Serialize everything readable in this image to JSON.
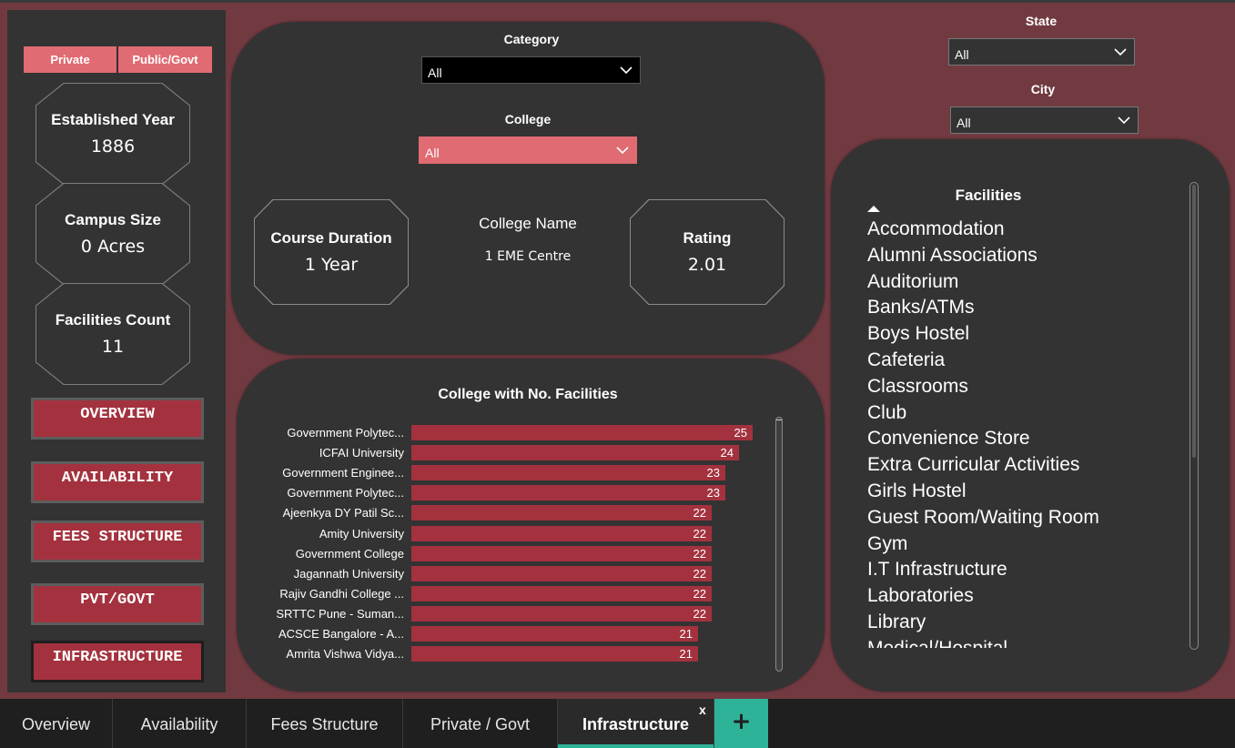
{
  "left": {
    "segments": [
      "Private",
      "Public/Govt"
    ],
    "kpis": [
      {
        "label": "Established Year",
        "value": "1886"
      },
      {
        "label": "Campus Size",
        "value": "0 Acres"
      },
      {
        "label": "Facilities Count",
        "value": "11"
      }
    ],
    "nav": [
      "OVERVIEW",
      "AVAILABILITY",
      "FEES STRUCTURE",
      "PVT/GOVT",
      "INFRASTRUCTURE"
    ]
  },
  "filters": {
    "category": {
      "title": "Category",
      "value": "All"
    },
    "college": {
      "title": "College",
      "value": "All"
    },
    "state": {
      "title": "State",
      "value": "All"
    },
    "city": {
      "title": "City",
      "value": "All"
    }
  },
  "center": {
    "course_duration": {
      "label": "Course Duration",
      "value": "1 Year"
    },
    "college_name": {
      "label": "College Name",
      "value": "1 EME Centre"
    },
    "rating": {
      "label": "Rating",
      "value": "2.01"
    }
  },
  "chart_data": {
    "type": "bar",
    "orientation": "horizontal",
    "title": "College with No. Facilities",
    "categories": [
      "Government Polytec...",
      "ICFAI University",
      "Government Enginee...",
      "Government Polytec...",
      "Ajeenkya DY Patil Sc...",
      "Amity University",
      "Government College",
      "Jagannath University",
      "Rajiv Gandhi College ...",
      "SRTTC Pune - Suman...",
      "ACSCE Bangalore - A...",
      "Amrita Vishwa Vidya..."
    ],
    "values": [
      25,
      24,
      23,
      23,
      22,
      22,
      22,
      22,
      22,
      22,
      21,
      21
    ],
    "color": "#a3323e"
  },
  "facilities": {
    "title": "Facilities",
    "items": [
      "Accommodation",
      "Alumni Associations",
      "Auditorium",
      "Banks/ATMs",
      "Boys Hostel",
      "Cafeteria",
      "Classrooms",
      "Club",
      "Convenience Store",
      "Extra Curricular Activities",
      "Girls Hostel",
      "Guest Room/Waiting Room",
      "Gym",
      "I.T Infrastructure",
      "Laboratories",
      "Library",
      "Medical/Hospital"
    ]
  },
  "tabs": [
    "Overview",
    "Availability",
    "Fees Structure",
    "Private / Govt",
    "Infrastructure"
  ],
  "active_tab": "Infrastructure",
  "tab_close": "x",
  "add_tab": "+",
  "colors": {
    "accent": "#e06b72",
    "bar": "#a3323e",
    "background": "#713a41",
    "panel": "#333333",
    "tab_underline": "#2eb398"
  }
}
